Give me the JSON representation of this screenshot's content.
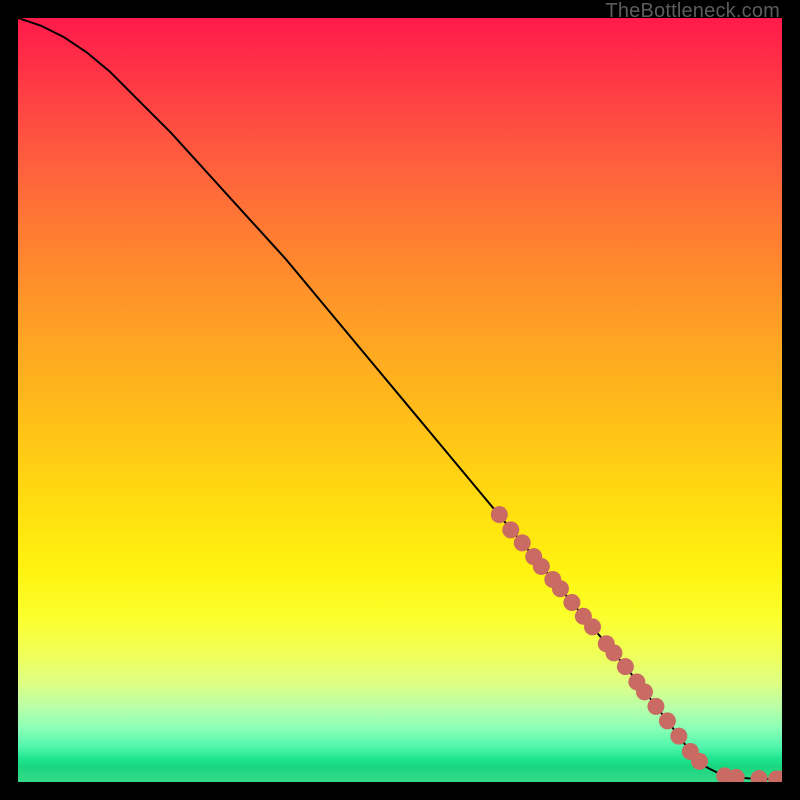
{
  "watermark": "TheBottleneck.com",
  "colors": {
    "curve": "#000000",
    "marker_fill": "#c96a63",
    "marker_stroke": "#8e3f3a",
    "gradient_top": "#ff1a4a",
    "gradient_bottom": "#34da88"
  },
  "chart_data": {
    "type": "line",
    "title": "",
    "xlabel": "",
    "ylabel": "",
    "xlim": [
      0,
      100
    ],
    "ylim": [
      0,
      100
    ],
    "grid": false,
    "legend": false,
    "series": [
      {
        "name": "curve",
        "kind": "line",
        "x": [
          0,
          3,
          6,
          9,
          12,
          15,
          20,
          25,
          30,
          35,
          40,
          45,
          50,
          55,
          60,
          65,
          70,
          75,
          80,
          85,
          88,
          90,
          92,
          94,
          96,
          98,
          100
        ],
        "y": [
          100,
          99,
          97.5,
          95.5,
          93,
          90,
          85,
          79.5,
          74,
          68.5,
          62.5,
          56.5,
          50.5,
          44.5,
          38.5,
          32.5,
          26.5,
          20.5,
          14.5,
          8,
          4,
          2,
          1,
          0.6,
          0.45,
          0.4,
          0.4
        ]
      },
      {
        "name": "markers",
        "kind": "scatter",
        "points": [
          {
            "x": 63,
            "y": 35
          },
          {
            "x": 64.5,
            "y": 33
          },
          {
            "x": 66,
            "y": 31.3
          },
          {
            "x": 67.5,
            "y": 29.5
          },
          {
            "x": 68.5,
            "y": 28.2
          },
          {
            "x": 70,
            "y": 26.5
          },
          {
            "x": 71,
            "y": 25.3
          },
          {
            "x": 72.5,
            "y": 23.5
          },
          {
            "x": 74,
            "y": 21.7
          },
          {
            "x": 75.2,
            "y": 20.3
          },
          {
            "x": 77,
            "y": 18.1
          },
          {
            "x": 78,
            "y": 16.9
          },
          {
            "x": 79.5,
            "y": 15.1
          },
          {
            "x": 81,
            "y": 13.1
          },
          {
            "x": 82,
            "y": 11.8
          },
          {
            "x": 83.5,
            "y": 9.9
          },
          {
            "x": 85,
            "y": 8
          },
          {
            "x": 86.5,
            "y": 6
          },
          {
            "x": 88,
            "y": 4
          },
          {
            "x": 89.2,
            "y": 2.7
          },
          {
            "x": 92.5,
            "y": 0.8
          },
          {
            "x": 94,
            "y": 0.6
          },
          {
            "x": 97,
            "y": 0.45
          },
          {
            "x": 99.3,
            "y": 0.4
          },
          {
            "x": 100,
            "y": 0.4
          }
        ]
      }
    ]
  }
}
